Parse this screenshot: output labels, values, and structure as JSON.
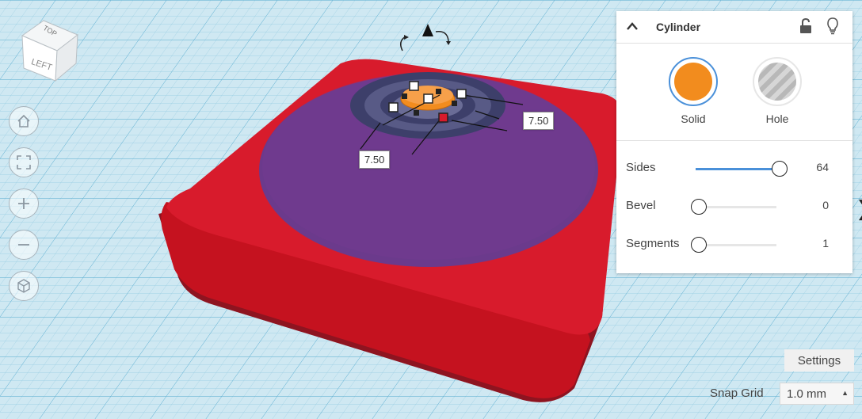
{
  "viewcube": {
    "top_label": "TOP",
    "left_label": "LEFT"
  },
  "dimensions": {
    "width_value": "7.50",
    "depth_value": "7.50"
  },
  "inspector": {
    "title": "Cylinder",
    "solid_label": "Solid",
    "hole_label": "Hole",
    "solid_color": "#f28c1e",
    "properties": [
      {
        "label": "Sides",
        "value": "64",
        "level": 1.0
      },
      {
        "label": "Bevel",
        "value": "0",
        "level": 0.0
      },
      {
        "label": "Segments",
        "value": "1",
        "level": 0.0
      }
    ]
  },
  "settings_label": "Settings",
  "snap_grid": {
    "label": "Snap Grid",
    "value": "1.0 mm"
  },
  "colors": {
    "base_red": "#d81b2c",
    "purple_disc": "#6b3a8c",
    "grid_bg": "#cfe8f2",
    "accent_blue": "#4a90d9"
  }
}
